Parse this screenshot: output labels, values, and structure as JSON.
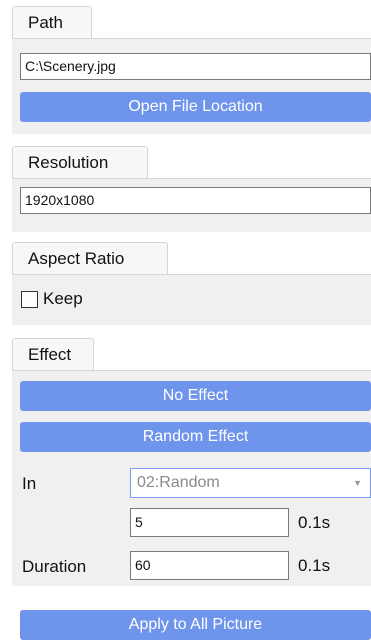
{
  "path": {
    "tab_label": "Path",
    "value": "C:\\Scenery.jpg",
    "open_button": "Open File Location"
  },
  "resolution": {
    "tab_label": "Resolution",
    "value": "1920x1080"
  },
  "aspect_ratio": {
    "tab_label": "Aspect Ratio",
    "keep_label": "Keep",
    "keep_checked": false
  },
  "effect": {
    "tab_label": "Effect",
    "no_effect_button": "No Effect",
    "random_effect_button": "Random Effect",
    "in_label": "In",
    "in_selected": "02:Random",
    "in_value": "5",
    "in_unit": "0.1s",
    "duration_label": "Duration",
    "duration_value": "60",
    "duration_unit": "0.1s"
  },
  "apply_button": "Apply to All Picture",
  "colors": {
    "accent_button": "#6f94ec",
    "panel_bg": "#f0f0f0"
  },
  "icons": {
    "dropdown_arrow": "chevron-down-icon"
  }
}
